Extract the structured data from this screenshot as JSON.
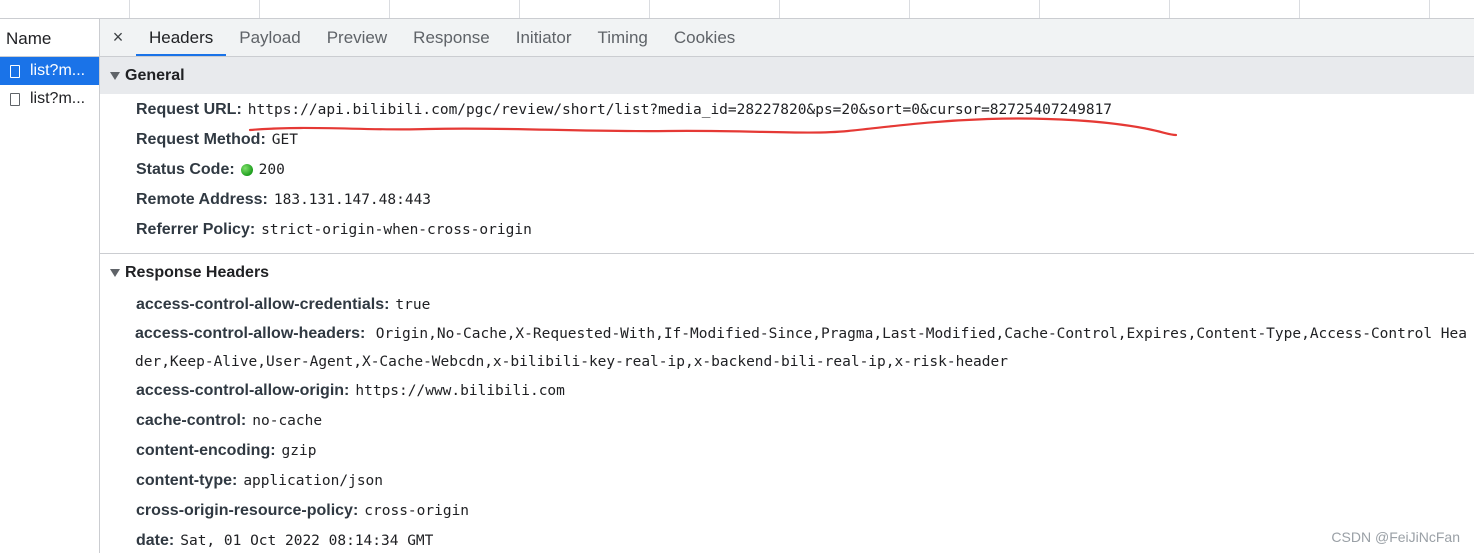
{
  "name_column": {
    "header": "Name",
    "requests": [
      {
        "label": "list?m...",
        "selected": true
      },
      {
        "label": "list?m...",
        "selected": false
      }
    ]
  },
  "tabs": {
    "close": "×",
    "items": [
      "Headers",
      "Payload",
      "Preview",
      "Response",
      "Initiator",
      "Timing",
      "Cookies"
    ],
    "active": "Headers"
  },
  "general": {
    "title": "General",
    "rows": [
      {
        "key": "Request URL:",
        "value": "https://api.bilibili.com/pgc/review/short/list?media_id=28227820&ps=20&sort=0&cursor=82725407249817"
      },
      {
        "key": "Request Method:",
        "value": "GET"
      },
      {
        "key": "Status Code:",
        "value": "200"
      },
      {
        "key": "Remote Address:",
        "value": "183.131.147.48:443"
      },
      {
        "key": "Referrer Policy:",
        "value": "strict-origin-when-cross-origin"
      }
    ]
  },
  "response_headers": {
    "title": "Response Headers",
    "rows": [
      {
        "key": "access-control-allow-credentials:",
        "value": "true"
      },
      {
        "key": "access-control-allow-headers:",
        "value": "Origin,No-Cache,X-Requested-With,If-Modified-Since,Pragma,Last-Modified,Cache-Control,Expires,Content-Type,Access-Control Header,Keep-Alive,User-Agent,X-Cache-Webcdn,x-bilibili-key-real-ip,x-backend-bili-real-ip,x-risk-header"
      },
      {
        "key": "access-control-allow-origin:",
        "value": "https://www.bilibili.com"
      },
      {
        "key": "cache-control:",
        "value": "no-cache"
      },
      {
        "key": "content-encoding:",
        "value": "gzip"
      },
      {
        "key": "content-type:",
        "value": "application/json"
      },
      {
        "key": "cross-origin-resource-policy:",
        "value": "cross-origin"
      },
      {
        "key": "date:",
        "value": "Sat, 01 Oct 2022 08:14:34 GMT"
      }
    ]
  },
  "watermark": "CSDN @FeiJiNcFan",
  "colors": {
    "accent": "#1a73e8",
    "annotation": "#e53935",
    "status_ok": "#1e9e1e"
  }
}
